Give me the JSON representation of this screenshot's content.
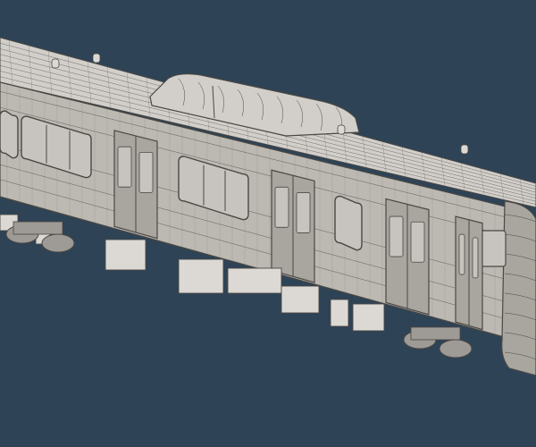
{
  "scene": {
    "background_color": "#2e4355",
    "body_color": "#bcb8b2",
    "body_shade_color": "#a9a59f",
    "roof_color": "#d2cfca",
    "wire_color": "#4a4845",
    "glass_color": "#c7c4bf",
    "undercarriage_color": "#9e9a95",
    "equipment_color": "#dcd9d4"
  }
}
